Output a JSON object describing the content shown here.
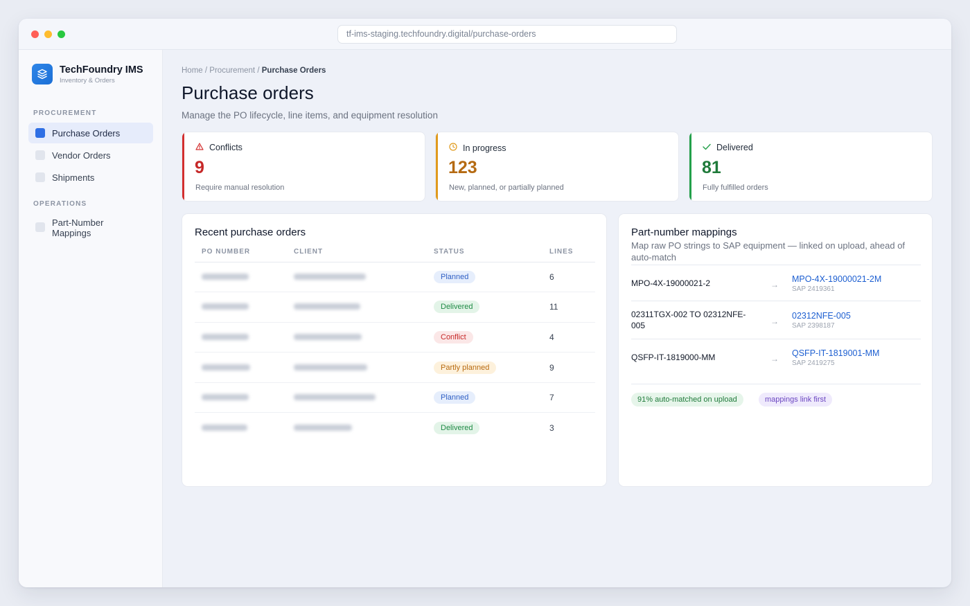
{
  "browser": {
    "url": "tf-ims-staging.techfoundry.digital/purchase-orders"
  },
  "sidebar": {
    "brand": {
      "name": "TechFoundry IMS",
      "subtitle": "Inventory & Orders",
      "icon": "layers-icon"
    },
    "sections": [
      {
        "label": "PROCUREMENT",
        "items": [
          {
            "label": "Purchase Orders",
            "active": true
          },
          {
            "label": "Vendor Orders",
            "active": false
          },
          {
            "label": "Shipments",
            "active": false
          }
        ]
      },
      {
        "label": "OPERATIONS",
        "items": [
          {
            "label": "Part-Number Mappings",
            "active": false
          }
        ]
      }
    ]
  },
  "header": {
    "breadcrumb": {
      "home": "Home",
      "sep": "/",
      "section": "Procurement",
      "current": "Purchase Orders"
    },
    "title": "Purchase orders",
    "subtitle": "Manage the PO lifecycle, line items, and equipment resolution"
  },
  "stats": [
    {
      "label": "Conflicts",
      "value": "9",
      "desc": "Require manual resolution",
      "icon": "warning-triangle-icon",
      "color": "#c62828",
      "bar": "#d32f2f"
    },
    {
      "label": "In progress",
      "value": "123",
      "desc": "New, planned, or partially planned",
      "icon": "clock-icon",
      "color": "#b56a12",
      "bar": "#e09a1c"
    },
    {
      "label": "Delivered",
      "value": "81",
      "desc": "Fully fulfilled orders",
      "icon": "check-icon",
      "color": "#1f7a3a",
      "bar": "#23a04a"
    }
  ],
  "recent_orders": {
    "title": "Recent purchase orders",
    "columns": [
      "PO NUMBER",
      "CLIENT",
      "STATUS",
      "LINES"
    ],
    "rows": [
      {
        "status": "Planned",
        "lines": "6"
      },
      {
        "status": "Delivered",
        "lines": "11"
      },
      {
        "status": "Conflict",
        "lines": "4"
      },
      {
        "status": "Partly planned",
        "lines": "9"
      },
      {
        "status": "Planned",
        "lines": "7"
      },
      {
        "status": "Delivered",
        "lines": "3"
      }
    ]
  },
  "mappings": {
    "title": "Part-number mappings",
    "description": "Map raw PO strings to SAP equipment — linked on upload, ahead of auto-match",
    "arrow": "→",
    "rows": [
      {
        "source": "MPO-4X-19000021-2",
        "target": "MPO-4X-19000021-2M",
        "sap": "SAP 2419361"
      },
      {
        "source": "02311TGX-002 TO 02312NFE-005",
        "target": "02312NFE-005",
        "sap": "SAP 2398187"
      },
      {
        "source": "QSFP-IT-1819000-MM",
        "target": "QSFP-IT-1819001-MM",
        "sap": "SAP 2419275"
      }
    ],
    "badges": {
      "auto_matched": "91% auto-matched on upload",
      "link_first": "mappings link first"
    }
  },
  "colors": {
    "accent": "#2f6fe4",
    "planned": "#2f6fe4",
    "delivered": "#1f8a45",
    "conflict": "#c62828",
    "partly": "#b86a10"
  }
}
